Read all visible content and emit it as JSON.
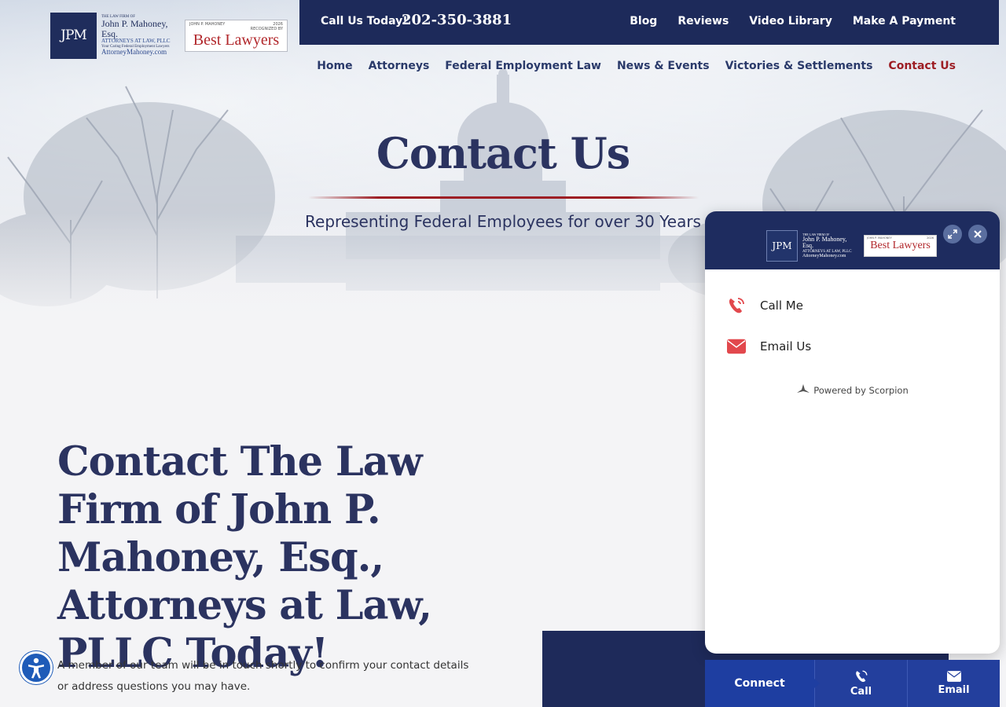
{
  "logo": {
    "mark": "JPM",
    "firm_small": "THE LAW FIRM OF",
    "firm_name": "John P. Mahoney, Esq.",
    "firm_sub": "ATTORNEYS AT LAW, PLLC",
    "tagline": "Your Caring Federal Employment Lawyers",
    "url": "AttorneyMahoney.com",
    "best_left": "JOHN P. MAHONEY",
    "best_right": "2026",
    "best_recognized": "RECOGNIZED BY",
    "best_word": "Best Lawyers"
  },
  "topbar": {
    "call_label": "Call Us Today!",
    "phone": "202-350-3881",
    "links": [
      "Blog",
      "Reviews",
      "Video Library",
      "Make A Payment"
    ]
  },
  "nav": {
    "items": [
      "Home",
      "Attorneys",
      "Federal Employment Law",
      "News & Events",
      "Victories & Settlements",
      "Contact Us"
    ],
    "active": "Contact Us"
  },
  "hero": {
    "title": "Contact Us",
    "subtitle": "Representing Federal Employees for over 30 Years"
  },
  "content": {
    "heading": "Contact The Law Firm of John P. Mahoney, Esq., Attorneys at Law, PLLC Today!",
    "body": "A member of our team will be in touch shortly to confirm your contact details or address questions you may have."
  },
  "widget": {
    "call_me": "Call Me",
    "email_us": "Email Us",
    "powered": "Powered by Scorpion"
  },
  "bottom_bar": {
    "connect": "Connect",
    "call": "Call",
    "email": "Email"
  },
  "colors": {
    "navy": "#1d2a5a",
    "accent_red": "#9d1e24",
    "bar_blue": "#233f9d"
  }
}
